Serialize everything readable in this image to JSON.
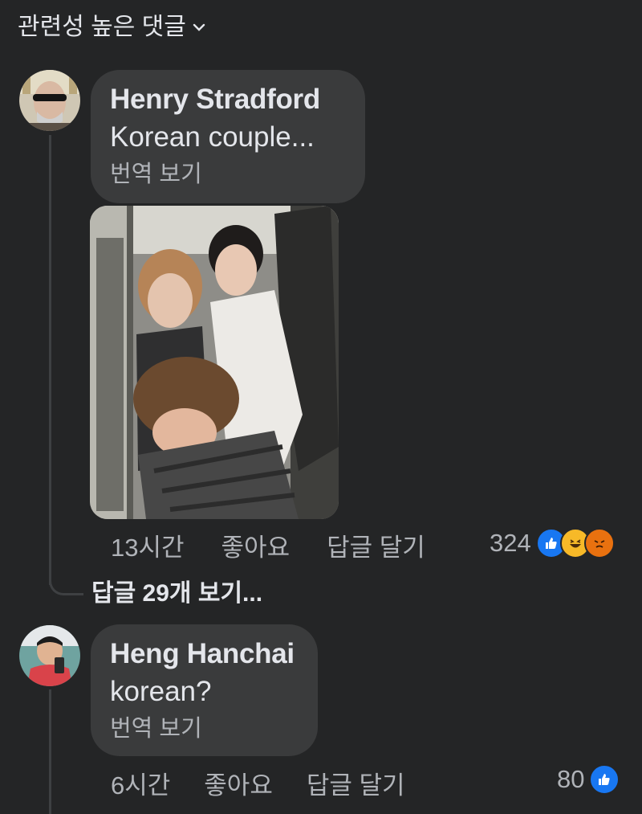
{
  "header": {
    "filter_label": "관련성 높은 댓글"
  },
  "comments": [
    {
      "author": "Henry Stradford",
      "text": "Korean couple...",
      "translate_label": "번역 보기",
      "time": "13시간",
      "like_label": "좋아요",
      "reply_label": "답글 달기",
      "reaction_count": "324",
      "reactions": [
        "like-icon",
        "haha-icon",
        "angry-icon"
      ],
      "view_replies": "답글 29개 보기..."
    },
    {
      "author": "Heng Hanchai",
      "text": "korean?",
      "translate_label": "번역 보기",
      "time": "6시간",
      "like_label": "좋아요",
      "reply_label": "답글 달기",
      "reaction_count": "80",
      "reactions": [
        "like-icon"
      ]
    }
  ],
  "colors": {
    "background": "#242526",
    "bubble": "#3a3b3c",
    "primary_text": "#e4e6eb",
    "secondary_text": "#b0b3b8",
    "like_blue": "#1877f2",
    "haha_yellow": "#f7b928",
    "angry_red": "#e9710f"
  }
}
